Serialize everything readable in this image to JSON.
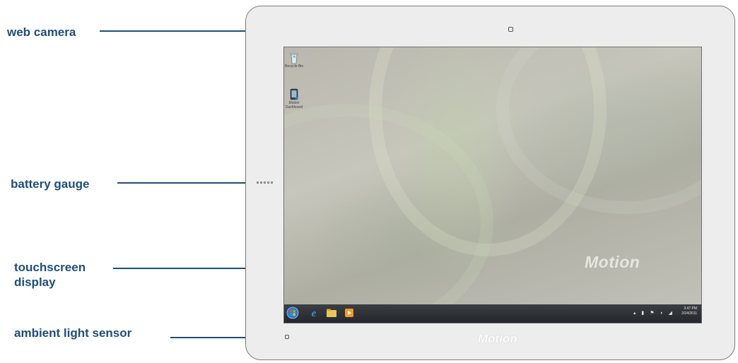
{
  "labels": {
    "web_camera": "web camera",
    "battery_gauge": "battery gauge",
    "touchscreen_display_line1": "touchscreen",
    "touchscreen_display_line2": "display",
    "ambient_light_sensor": "ambient light sensor"
  },
  "device": {
    "brand_screen": "Motion",
    "brand_bezel": "Motion",
    "battery_gauge_dots": 5
  },
  "desktop": {
    "icons": [
      {
        "icon": "recycle-bin-icon",
        "label": "Recycle Bin"
      },
      {
        "icon": "tablet-shortcut-icon",
        "label": "Motion Dashboard"
      }
    ],
    "taskbar": {
      "items": [
        "start-orb-icon",
        "internet-explorer-icon",
        "folder-icon",
        "media-player-icon"
      ],
      "time": "3:47 PM",
      "date": "2/24/2011"
    }
  },
  "colors": {
    "callout": "#1f4e79",
    "bezel": "#ededed",
    "bezel_border": "#7b7b7b",
    "taskbar": "#2d3035"
  }
}
